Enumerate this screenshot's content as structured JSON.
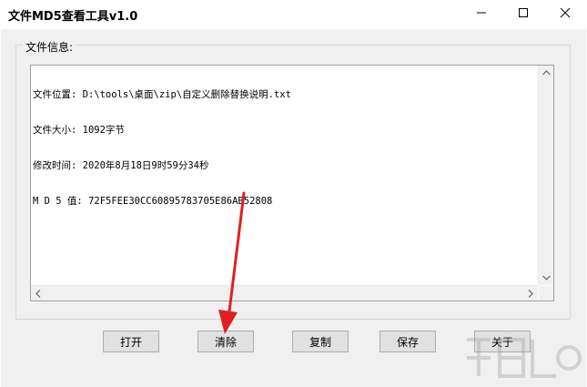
{
  "window": {
    "title": "文件MD5查看工具v1.0"
  },
  "group": {
    "label": "文件信息:"
  },
  "info": {
    "lines": [
      "文件位置: D:\\tools\\桌面\\zip\\自定义删除替换说明.txt",
      "文件大小: 1092字节",
      "修改时间: 2020年8月18日9时59分34秒",
      "M D 5 值: 72F5FEE30CC60895783705E86AB52808"
    ]
  },
  "buttons": {
    "open": "打开",
    "clear": "清除",
    "copy": "复制",
    "save": "保存",
    "about": "关于"
  },
  "colors": {
    "annotation_arrow": "#e02020",
    "button_face": "#e1e1e1",
    "client_bg": "#f0f0f0"
  },
  "icons": [
    "minimize-icon",
    "maximize-icon",
    "close-icon",
    "scroll-up-icon",
    "scroll-down-icon",
    "scroll-left-icon",
    "scroll-right-icon"
  ]
}
